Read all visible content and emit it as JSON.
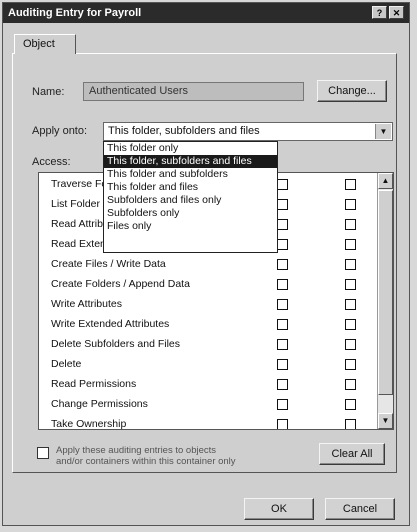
{
  "window": {
    "title": "Auditing Entry for Payroll",
    "help_btn": "?",
    "close_btn": "✕"
  },
  "tabs": [
    {
      "label": "Object"
    }
  ],
  "name_field": {
    "label": "Name:",
    "value": "Authenticated Users",
    "change_button": "Change..."
  },
  "apply_onto": {
    "label": "Apply onto:",
    "value": "This folder, subfolders and files",
    "options": [
      "This folder only",
      "This folder, subfolders and files",
      "This folder and subfolders",
      "This folder and files",
      "Subfolders and files only",
      "Subfolders only",
      "Files only"
    ],
    "selected_index": 1
  },
  "access": {
    "label": "Access:",
    "rows": [
      "Traverse Folder / Execute File",
      "List Folder / Read Data",
      "Read Attributes",
      "Read Extended Attributes",
      "Create Files / Write Data",
      "Create Folders / Append Data",
      "Write Attributes",
      "Write Extended Attributes",
      "Delete Subfolders and Files",
      "Delete",
      "Read Permissions",
      "Change Permissions",
      "Take Ownership"
    ]
  },
  "apply_checkbox": {
    "label_line1": "Apply these auditing entries to objects",
    "label_line2": "and/or containers within this container only"
  },
  "clear_all": "Clear All",
  "ok": "OK",
  "cancel": "Cancel"
}
